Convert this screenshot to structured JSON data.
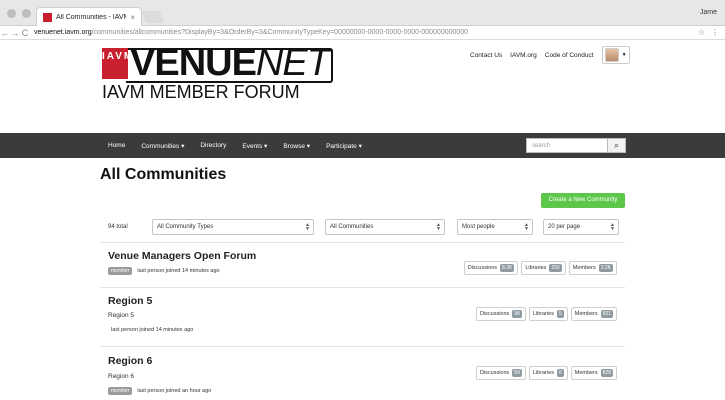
{
  "browser": {
    "tab_title": "All Communities - IAVM | Ven",
    "tab_close": "×",
    "user": "Jame",
    "url_host": "venuenet.iavm.org",
    "url_path": "/communities/allcommunities?DisplayBy=3&OrderBy=3&CommunityTypeKey=00000000-0000-0000-0000-000000000000",
    "back": "←",
    "forward": "→",
    "reload": "C",
    "star": "☆",
    "menu": "⋮"
  },
  "header": {
    "logo_iavm": "IAVM",
    "logo_venue": "VENUE",
    "logo_net": "NET",
    "logo_forum": "IAVM MEMBER FORUM",
    "links": [
      "Contact Us",
      "IAVM.org",
      "Code of Conduct"
    ]
  },
  "nav": {
    "items": [
      "Home",
      "Communities ▾",
      "Directory",
      "Events ▾",
      "Browse ▾",
      "Participate ▾"
    ],
    "search_placeholder": "search",
    "search_icon": "⌕"
  },
  "page": {
    "title": "All Communities",
    "create_button": "Create a New Community",
    "total": "94 total",
    "filters": {
      "types": "All Community Types",
      "communities": "All Communities",
      "sort": "Most people",
      "per_page": "20 per page"
    }
  },
  "communities": [
    {
      "title": "Venue Managers Open Forum",
      "subtitle": "",
      "badge": "member",
      "activity": "last person joined 14 minutes ago",
      "stats": [
        {
          "label": "Discussions",
          "value": "8.2K"
        },
        {
          "label": "Libraries",
          "value": "250"
        },
        {
          "label": "Members",
          "value": "3.2K"
        }
      ]
    },
    {
      "title": "Region 5",
      "subtitle": "Region 5",
      "badge": "",
      "activity": "last person joined 14 minutes ago",
      "stats": [
        {
          "label": "Discussions",
          "value": "98"
        },
        {
          "label": "Libraries",
          "value": "5"
        },
        {
          "label": "Members",
          "value": "921"
        }
      ]
    },
    {
      "title": "Region 6",
      "subtitle": "Region 6",
      "badge": "member",
      "activity": "last person joined an hour ago",
      "stats": [
        {
          "label": "Discussions",
          "value": "59"
        },
        {
          "label": "Libraries",
          "value": "6"
        },
        {
          "label": "Members",
          "value": "828"
        }
      ]
    }
  ]
}
